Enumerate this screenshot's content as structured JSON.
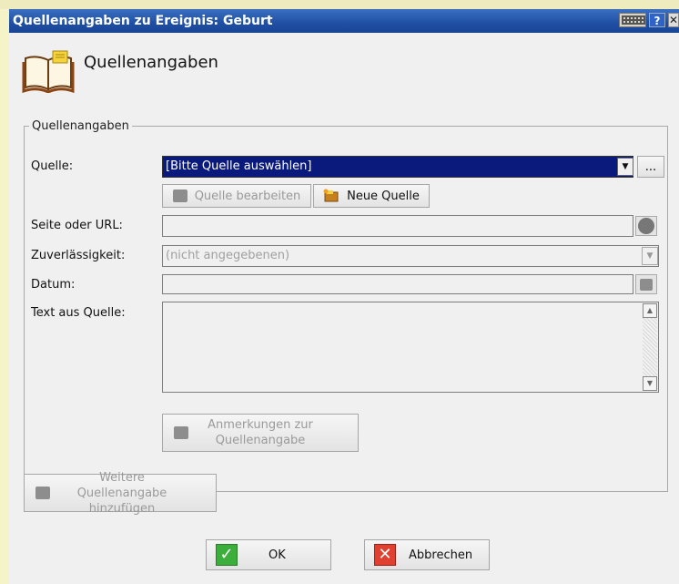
{
  "window": {
    "title": "Quellenangaben zu Ereignis: Geburt"
  },
  "header": {
    "title": "Quellenangaben"
  },
  "group": {
    "legend": "Quellenangaben",
    "source_label": "Quelle:",
    "source_value": "[Bitte Quelle auswählen]",
    "browse_label": "...",
    "edit_source_label": "Quelle bearbeiten",
    "new_source_label": "Neue Quelle",
    "page_label": "Seite oder URL:",
    "page_value": "",
    "reliability_label": "Zuverlässigkeit:",
    "reliability_value": "(nicht angegebenen)",
    "date_label": "Datum:",
    "date_value": "",
    "text_label": "Text aus Quelle:",
    "text_value": "",
    "notes_button_label": "Anmerkungen zur Quellenangabe"
  },
  "footer": {
    "add_more_label": "Weitere Quellenangabe hinzufügen",
    "ok_label": "OK",
    "cancel_label": "Abbrechen"
  },
  "colors": {
    "titlebar": "#1f4fa3",
    "selected_select": "#0a1a7c",
    "dialog_bg": "#f0f0f0",
    "desktop": "#f5f3c8"
  }
}
